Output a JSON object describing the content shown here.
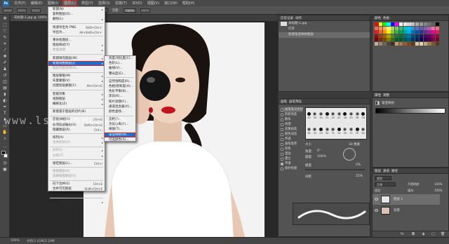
{
  "menubar": {
    "app": "Ps",
    "items": [
      "文件(F)",
      "编辑(E)",
      "图像(I)",
      "图层(L)",
      "类型(Y)",
      "选择(S)",
      "滤镜(T)",
      "3D(D)",
      "视图(V)",
      "窗口(W)",
      "帮助(H)"
    ],
    "active_index": 3
  },
  "options": {
    "opacity_label": "不透明度:",
    "opacity": "100%",
    "flow_label": "流量:",
    "flow": "100%"
  },
  "document": {
    "tab": "未标题-1.jpg @ 100% (图层 1, RGB/8#)",
    "zoom": "100%",
    "doc_info": "文档:1.41M/3.19M"
  },
  "layer_menu": {
    "items": [
      {
        "label": "新建(N)",
        "arrow": true
      },
      {
        "label": "复制图层(D)..."
      },
      {
        "label": "删除(L)",
        "arrow": true
      },
      {
        "sep": true
      },
      {
        "label": "快速导出为 PNG",
        "shortcut": "Shift+Ctrl+'"
      },
      {
        "label": "导出为...",
        "shortcut": "Alt+Shift+Ctrl+'"
      },
      {
        "sep": true
      },
      {
        "label": "重命名图层..."
      },
      {
        "label": "图层样式(Y)",
        "arrow": true
      },
      {
        "label": "智能滤镜",
        "arrow": true,
        "disabled": true
      },
      {
        "sep": true
      },
      {
        "label": "新建填充图层(W)",
        "arrow": true
      },
      {
        "label": "新建调整图层(J)",
        "arrow": true,
        "highlight": true
      },
      {
        "label": "图层内容选项(O)...",
        "disabled": true
      },
      {
        "sep": true
      },
      {
        "label": "图层蒙版(M)",
        "arrow": true
      },
      {
        "label": "矢量蒙版(V)",
        "arrow": true
      },
      {
        "label": "创建剪贴蒙版(C)",
        "shortcut": "Alt+Ctrl+G"
      },
      {
        "sep": true
      },
      {
        "label": "智能对象",
        "arrow": true
      },
      {
        "label": "视频图层",
        "arrow": true
      },
      {
        "label": "栅格化(Z)",
        "arrow": true
      },
      {
        "sep": true
      },
      {
        "label": "新建基于图层的切片(B)"
      },
      {
        "sep": true
      },
      {
        "label": "图层编组(G)",
        "shortcut": "Ctrl+G"
      },
      {
        "label": "取消图层编组(U)",
        "shortcut": "Shift+Ctrl+G"
      },
      {
        "label": "隐藏图层(R)",
        "shortcut": "Ctrl+,"
      },
      {
        "sep": true
      },
      {
        "label": "排列(A)",
        "arrow": true
      },
      {
        "label": "合并形状(H)",
        "arrow": true,
        "disabled": true
      },
      {
        "sep": true
      },
      {
        "label": "对齐(I)",
        "arrow": true,
        "disabled": true
      },
      {
        "label": "分布(T)",
        "arrow": true,
        "disabled": true
      },
      {
        "sep": true
      },
      {
        "label": "锁定图层(L)...",
        "shortcut": "Ctrl+/"
      },
      {
        "sep": true
      },
      {
        "label": "链接图层(K)",
        "disabled": true
      },
      {
        "label": "选择链接图层(S)",
        "disabled": true
      },
      {
        "sep": true
      },
      {
        "label": "向下合并(E)",
        "shortcut": "Ctrl+E"
      },
      {
        "label": "合并可见图层",
        "shortcut": "Shift+Ctrl+E"
      },
      {
        "label": "拼合图像(F)"
      },
      {
        "sep": true
      },
      {
        "label": "修边",
        "arrow": true
      }
    ]
  },
  "adjust_menu": {
    "items": [
      {
        "label": "亮度/对比度(C)..."
      },
      {
        "label": "色阶(L)..."
      },
      {
        "label": "曲线(V)..."
      },
      {
        "label": "曝光度(E)..."
      },
      {
        "sep": true
      },
      {
        "label": "自然饱和度(R)..."
      },
      {
        "label": "色相/饱和度(H)..."
      },
      {
        "label": "色彩平衡(B)..."
      },
      {
        "label": "黑白(K)..."
      },
      {
        "label": "照片滤镜(F)..."
      },
      {
        "label": "通道混合器(X)..."
      },
      {
        "label": "颜色查找..."
      },
      {
        "sep": true
      },
      {
        "label": "反相(I)..."
      },
      {
        "label": "色调分离(P)..."
      },
      {
        "label": "阈值(T)..."
      },
      {
        "label": "渐变映射(M)...",
        "highlight": true
      },
      {
        "label": "可选颜色(S)..."
      }
    ]
  },
  "history_panel": {
    "tabs": [
      "历史记录",
      "动作"
    ],
    "doc": "未标题-1.jpg",
    "rows": [
      "打开",
      "新建渐变映射图层"
    ]
  },
  "swatches_panel": {
    "tabs": [
      "颜色",
      "色板"
    ],
    "colors": [
      "#ff0000",
      "#ffff00",
      "#00ff00",
      "#00ffff",
      "#0000ff",
      "#ff00ff",
      "#ffffff",
      "#ebebeb",
      "#d6d6d6",
      "#c2c2c2",
      "#adadad",
      "#999999",
      "#858585",
      "#707070",
      "#5c5c5c",
      "#000000",
      "#f26c4f",
      "#f68e56",
      "#fbaf5d",
      "#fff467",
      "#acd372",
      "#7cc576",
      "#3bb878",
      "#1abbb4",
      "#00bff3",
      "#438ccb",
      "#5574b9",
      "#605ca8",
      "#855fa8",
      "#a763a8",
      "#f06ea9",
      "#f26d7d",
      "#ed1c24",
      "#f26522",
      "#f7941d",
      "#fff200",
      "#8dc63f",
      "#39b54a",
      "#00a651",
      "#00a99d",
      "#00aeef",
      "#0072bc",
      "#0054a6",
      "#2e3192",
      "#662d91",
      "#92278f",
      "#ec008c",
      "#ed145b",
      "#9e0b0f",
      "#a0410d",
      "#a3620a",
      "#aba000",
      "#598527",
      "#1a7b30",
      "#007236",
      "#00746b",
      "#0076a3",
      "#004b80",
      "#003471",
      "#1b1464",
      "#440e62",
      "#630460",
      "#9e005d",
      "#9e0039",
      "#790000",
      "#7b2e00",
      "#7d4900",
      "#827b00",
      "#406618",
      "#005e20",
      "#005826",
      "#005952",
      "#005b7f",
      "#003663",
      "#002157",
      "#0d004c",
      "#32004b",
      "#4b0049",
      "#7b0046",
      "#7a0026",
      "#c7b299",
      "#998675",
      "#736357",
      "#534741",
      "#37302d",
      "#c69c6d",
      "#a67c52",
      "#8c6239",
      "#754c24",
      "#603913",
      "#dfc8a2",
      "#e3d4b4",
      "#bfa67c",
      "#9a7a4a",
      "#7a5a2a",
      "#5a3a1a"
    ]
  },
  "brush_panel": {
    "tabs": [
      "画笔",
      "画笔预设"
    ],
    "sizes": [
      "30",
      "30",
      "30",
      "25",
      "25",
      "25",
      "36",
      "25",
      "36",
      "36",
      "36",
      "32",
      "25",
      "50",
      "71",
      "25",
      "50",
      "71",
      "25",
      "50"
    ],
    "options": [
      {
        "label": "画笔笔尖形状",
        "checked": false,
        "highlight": true
      },
      {
        "label": "形状动态",
        "checked": false
      },
      {
        "label": "散布",
        "checked": false
      },
      {
        "label": "纹理",
        "checked": false
      },
      {
        "label": "双重画笔",
        "checked": false
      },
      {
        "label": "颜色动态",
        "checked": false
      },
      {
        "label": "传递",
        "checked": false
      },
      {
        "label": "画笔笔势",
        "checked": false
      },
      {
        "label": "杂色",
        "checked": false
      },
      {
        "label": "湿边",
        "checked": false
      },
      {
        "label": "建立",
        "checked": false
      },
      {
        "label": "平滑",
        "checked": true
      },
      {
        "label": "保护纹理",
        "checked": false
      }
    ],
    "size_label": "大小",
    "size_value": "30 像素",
    "angle_label": "角度:",
    "angle_value": "0°",
    "roundness_label": "圆度:",
    "roundness_value": "100%",
    "hardness_label": "硬度",
    "hardness_value": "0%",
    "spacing_label": "间距",
    "spacing_value": "25%"
  },
  "properties_panel": {
    "tabs": [
      "属性",
      "调整"
    ],
    "title": "渐变映射",
    "mode": "外观: ",
    "opacity_label": "不透明度:",
    "opacity": "100%",
    "fill_label": "填充:",
    "fill": "100%"
  },
  "layers_panel": {
    "tabs": [
      "图层",
      "通道",
      "路径"
    ],
    "kind": "类型",
    "blend": "正常",
    "opacity_label": "不透明度:",
    "opacity": "100%",
    "lock_label": "锁定:",
    "fill_label": "填充:",
    "fill": "100%",
    "rows": [
      {
        "name": "图层 1",
        "selected": true
      },
      {
        "name": "背景",
        "selected": false
      }
    ]
  },
  "watermark": "www.lsoSuoHe.com"
}
